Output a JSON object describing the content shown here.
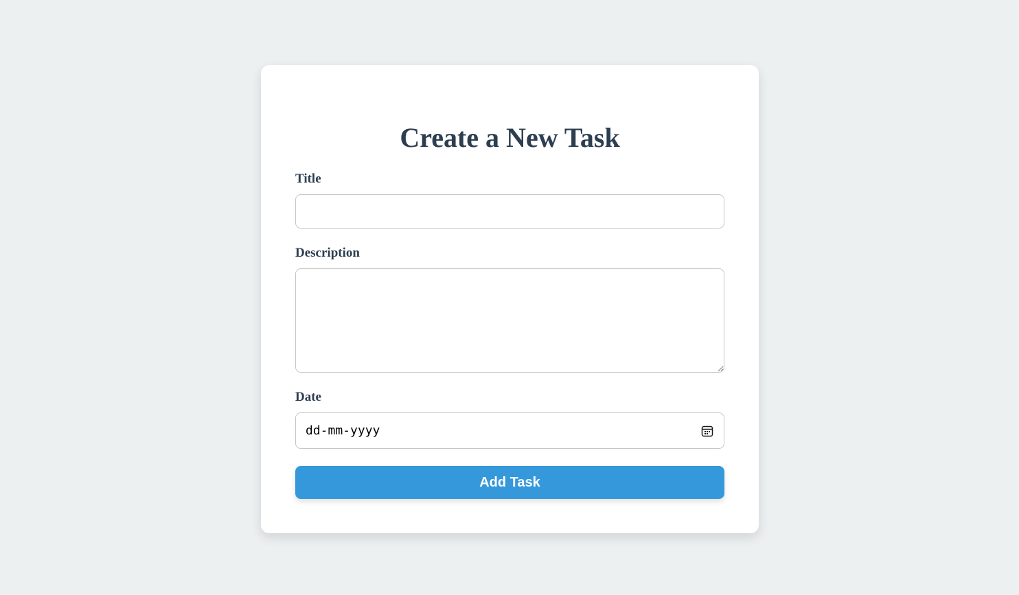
{
  "form": {
    "heading": "Create a New Task",
    "title_label": "Title",
    "title_value": "",
    "description_label": "Description",
    "description_value": "",
    "date_label": "Date",
    "date_placeholder": "dd-mm-yyyy",
    "calendar_icon": "calendar-icon",
    "submit_label": "Add Task"
  },
  "colors": {
    "page_background": "#ecf0f1",
    "card_background": "#ffffff",
    "text": "#2c3e50",
    "accent": "#3498db"
  }
}
